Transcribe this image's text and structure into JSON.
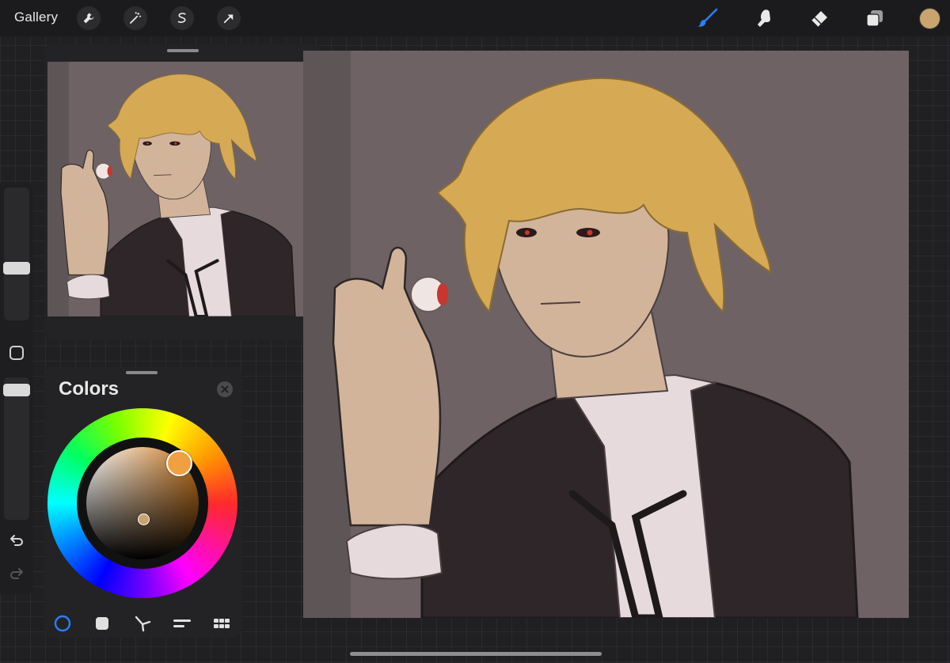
{
  "toolbar": {
    "gallery_label": "Gallery",
    "left_tools": [
      "wrench-icon",
      "magic-wand-icon",
      "selection-icon",
      "transform-arrow-icon"
    ],
    "right_tools": [
      "brush-icon",
      "smudge-icon",
      "eraser-icon",
      "layers-icon"
    ],
    "active_tool": "brush",
    "active_color": "#c9a46f",
    "brush_accent": "#2f7cf6"
  },
  "sidebar": {
    "brush_size_level": 0.38,
    "opacity_level": 0.95,
    "undo_icon": "undo-icon",
    "redo_icon": "redo-icon"
  },
  "reference_panel": {
    "image_description_icon": "reference-image"
  },
  "colors_panel": {
    "title": "Colors",
    "close_icon": "close-icon",
    "hue_color": "#f0a040",
    "tabs": [
      "disc-tab",
      "classic-tab",
      "harmony-tab",
      "value-tab",
      "palettes-tab"
    ],
    "active_tab": "disc-tab",
    "active_tab_color": "#2f7cf6"
  },
  "artwork": {
    "background": "#6e6264",
    "hair": "#d6a955",
    "skin": "#d2b49a",
    "jacket": "#2e2628",
    "shirt": "#e7dadd",
    "eye": "#c8362e"
  }
}
